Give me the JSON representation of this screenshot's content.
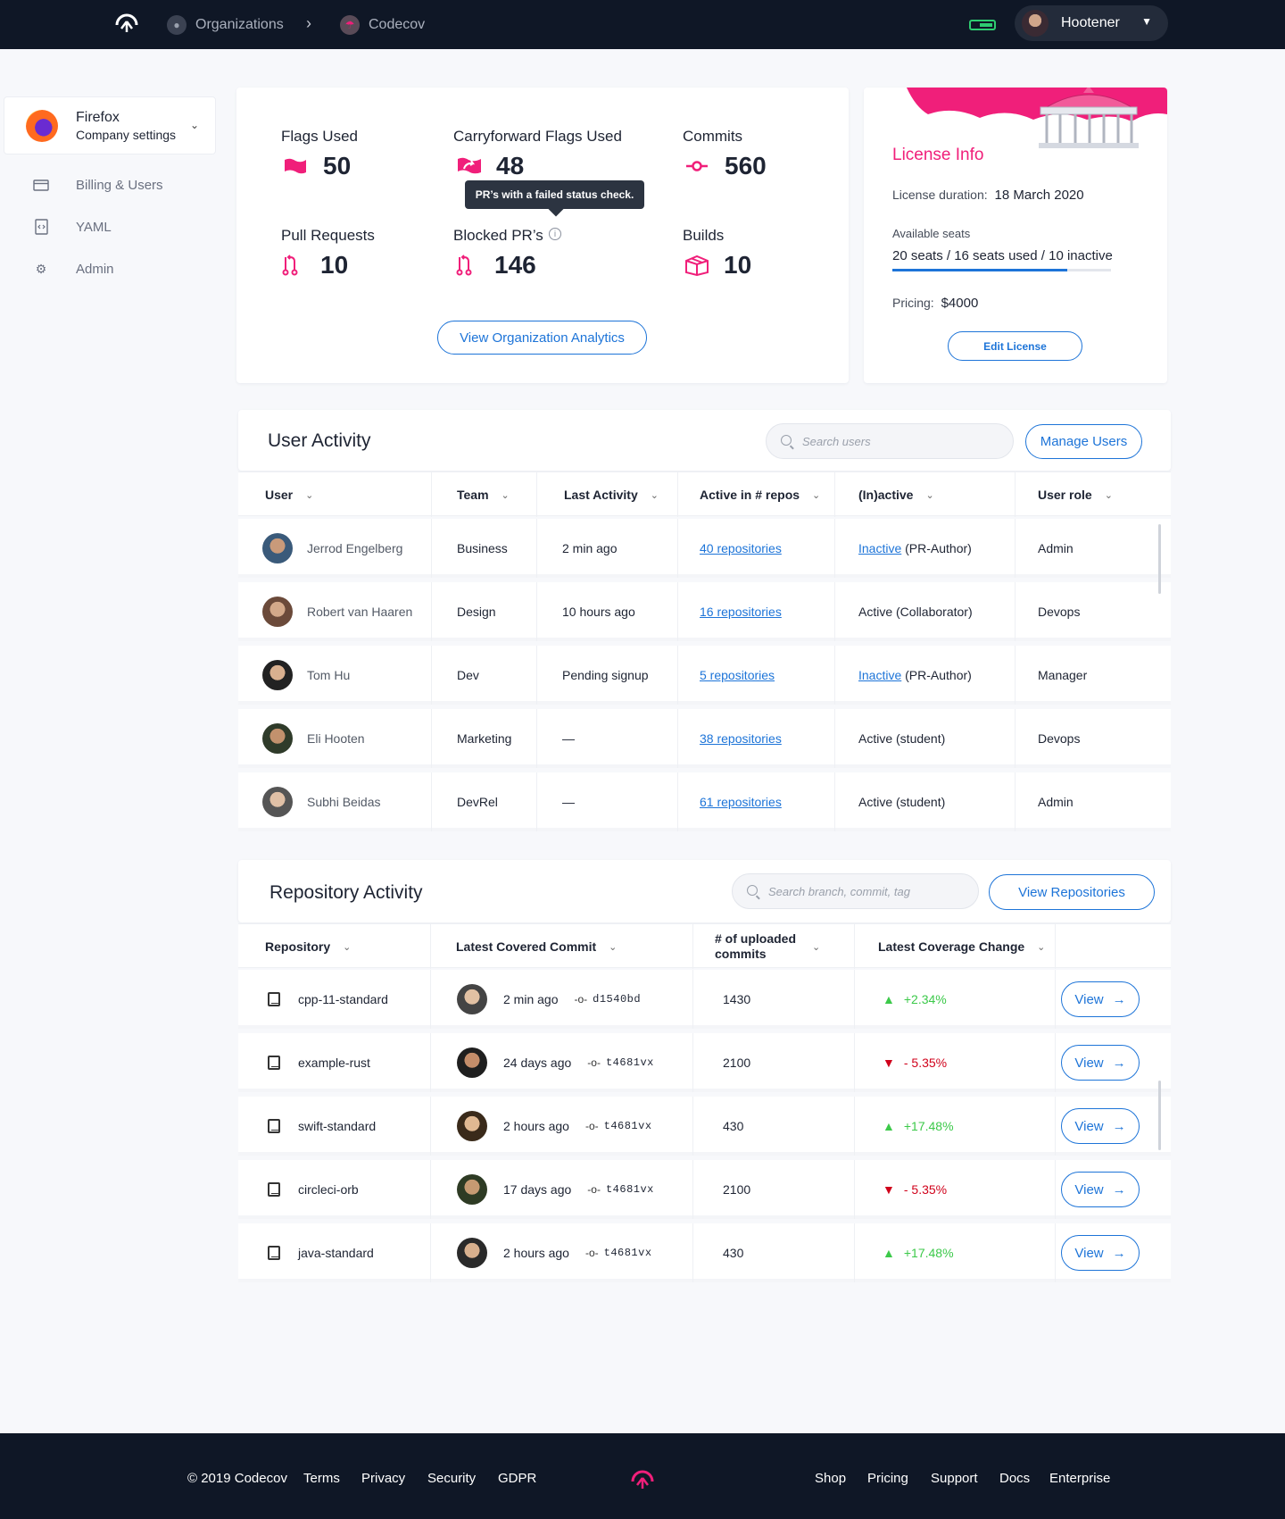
{
  "topbar": {
    "crumbs": [
      "Organizations",
      "Codecov"
    ],
    "separator": "›",
    "user": "Hootener"
  },
  "sidebar": {
    "org_name": "Firefox",
    "org_sub": "Company settings",
    "items": [
      {
        "label": "Billing & Users",
        "icon": "card-icon"
      },
      {
        "label": "YAML",
        "icon": "code-file-icon"
      },
      {
        "label": "Admin",
        "icon": "gear-icon"
      }
    ]
  },
  "stats": {
    "flags_label": "Flags Used",
    "flags_value": "50",
    "carry_label": "Carryforward Flags Used",
    "carry_value": "48",
    "commits_label": "Commits",
    "commits_value": "560",
    "pr_label": "Pull Requests",
    "pr_value": "10",
    "blocked_label": "Blocked PR’s",
    "blocked_value": "146",
    "builds_label": "Builds",
    "builds_value": "10",
    "tooltip": "PR’s with a failed status check.",
    "analytics_button": "View Organization Analytics"
  },
  "license": {
    "title": "License Info",
    "duration_label": "License duration:",
    "duration_value": "18 March 2020",
    "seats_label": "Available seats",
    "seats_value": "20 seats / 16 seats used / 10 inactive",
    "seats_used_fraction": 0.8,
    "pricing_label": "Pricing:",
    "pricing_value": "$4000",
    "edit_button": "Edit License"
  },
  "user_activity": {
    "title": "User Activity",
    "search_placeholder": "Search users",
    "manage_button": "Manage Users",
    "columns": [
      "User",
      "Team",
      "Last Activity",
      "Active in # repos",
      "(In)active",
      "User role"
    ],
    "rows": [
      {
        "name": "Jerrod Engelberg",
        "team": "Business",
        "last": "2 min ago",
        "repos": "40 repositories",
        "status_link": "Inactive",
        "status_rest": " (PR-Author)",
        "role": "Admin"
      },
      {
        "name": "Robert van Haaren",
        "team": "Design",
        "last": "10 hours ago",
        "repos": "16 repositories",
        "status_link": "",
        "status_rest": "Active (Collaborator)",
        "role": "Devops"
      },
      {
        "name": "Tom Hu",
        "team": "Dev",
        "last": "Pending signup",
        "repos": "5 repositories",
        "status_link": "Inactive",
        "status_rest": " (PR-Author)",
        "role": "Manager"
      },
      {
        "name": "Eli Hooten",
        "team": "Marketing",
        "last": "—",
        "repos": "38 repositories",
        "status_link": "",
        "status_rest": "Active (student)",
        "role": "Devops"
      },
      {
        "name": "Subhi Beidas",
        "team": "DevRel",
        "last": "—",
        "repos": "61 repositories",
        "status_link": "",
        "status_rest": "Active (student)",
        "role": "Admin"
      }
    ]
  },
  "repo_activity": {
    "title": "Repository Activity",
    "search_placeholder": "Search branch, commit, tag",
    "view_button": "View Repositories",
    "columns": [
      "Repository",
      "Latest Covered Commit",
      "# of uploaded commits",
      "Latest Coverage Change"
    ],
    "view_label": "View",
    "rows": [
      {
        "repo": "cpp-11-standard",
        "time": "2 min ago",
        "hash": "d1540bd",
        "uploads": "1430",
        "change": "+2.34%",
        "dir": "up"
      },
      {
        "repo": "example-rust",
        "time": "24 days ago",
        "hash": "t4681vx",
        "uploads": "2100",
        "change": "- 5.35%",
        "dir": "down"
      },
      {
        "repo": "swift-standard",
        "time": "2 hours ago",
        "hash": "t4681vx",
        "uploads": "430",
        "change": "+17.48%",
        "dir": "up"
      },
      {
        "repo": "circleci-orb",
        "time": "17 days ago",
        "hash": "t4681vx",
        "uploads": "2100",
        "change": "- 5.35%",
        "dir": "down"
      },
      {
        "repo": "java-standard",
        "time": "2 hours ago",
        "hash": "t4681vx",
        "uploads": "430",
        "change": "+17.48%",
        "dir": "up"
      }
    ]
  },
  "footer": {
    "left": [
      "© 2019 Codecov",
      "Terms",
      "Privacy",
      "Security",
      "GDPR"
    ],
    "right": [
      "Shop",
      "Pricing",
      "Support",
      "Docs",
      "Enterprise"
    ]
  },
  "colors": {
    "accent": "#1d74d8",
    "brand": "#f01f7a",
    "up": "#3cc94a",
    "down": "#d0021b",
    "dark": "#0f1726"
  }
}
